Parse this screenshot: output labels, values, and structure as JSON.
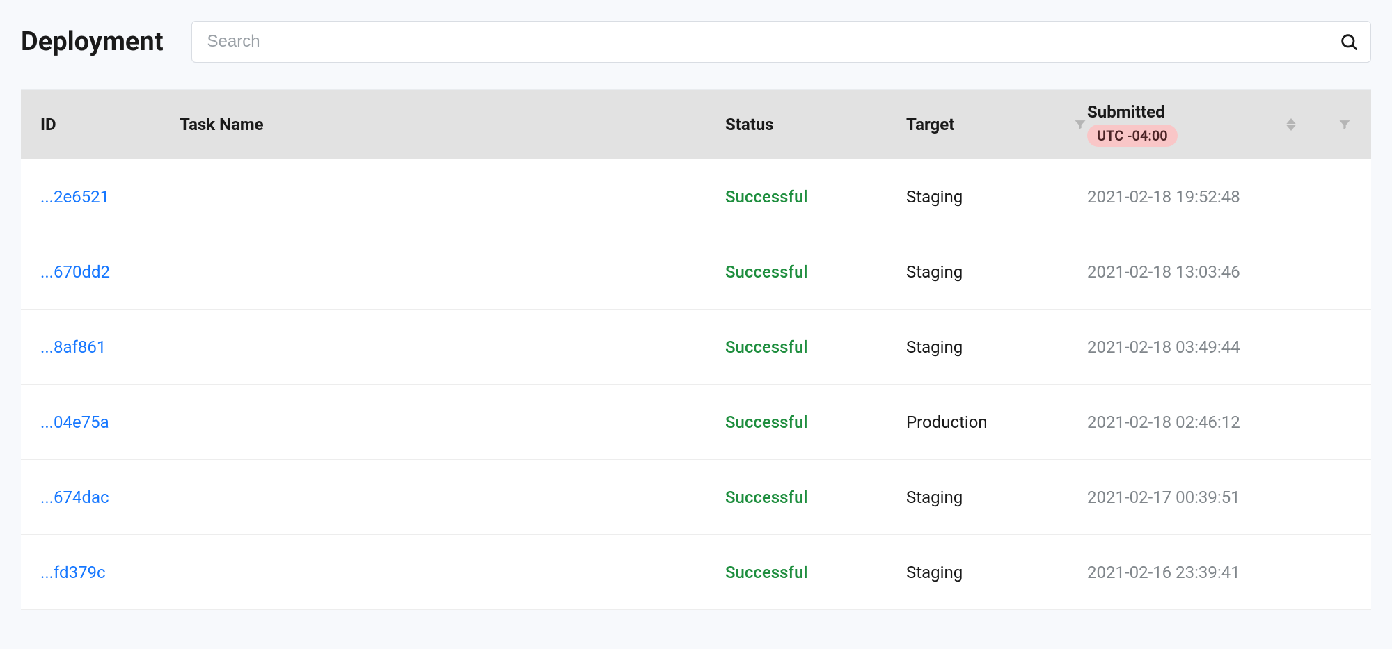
{
  "header": {
    "title": "Deployment",
    "search_placeholder": "Search"
  },
  "table": {
    "columns": {
      "id": "ID",
      "task_name": "Task Name",
      "status": "Status",
      "target": "Target",
      "submitted": "Submitted",
      "utc_badge": "UTC -04:00"
    },
    "rows": [
      {
        "id": "...2e6521",
        "task_name": "",
        "status": "Successful",
        "target": "Staging",
        "submitted": "2021-02-18 19:52:48"
      },
      {
        "id": "...670dd2",
        "task_name": "",
        "status": "Successful",
        "target": "Staging",
        "submitted": "2021-02-18 13:03:46"
      },
      {
        "id": "...8af861",
        "task_name": "",
        "status": "Successful",
        "target": "Staging",
        "submitted": "2021-02-18 03:49:44"
      },
      {
        "id": "...04e75a",
        "task_name": "",
        "status": "Successful",
        "target": "Production",
        "submitted": "2021-02-18 02:46:12"
      },
      {
        "id": "...674dac",
        "task_name": "",
        "status": "Successful",
        "target": "Staging",
        "submitted": "2021-02-17 00:39:51"
      },
      {
        "id": "...fd379c",
        "task_name": "",
        "status": "Successful",
        "target": "Staging",
        "submitted": "2021-02-16 23:39:41"
      }
    ]
  }
}
